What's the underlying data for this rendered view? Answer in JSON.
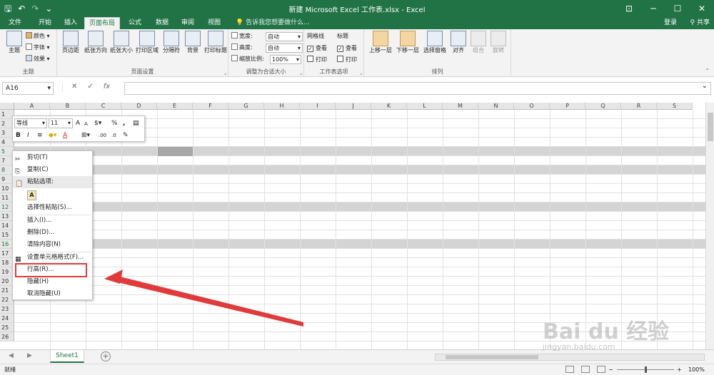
{
  "title_bar": {
    "title": "新建 Microsoft Excel 工作表.xlsx - Excel",
    "qat_icons": [
      "save-icon",
      "undo-icon",
      "redo-icon",
      "customize-icon"
    ],
    "window_controls": [
      "ribbon-display-icon",
      "minimize-icon",
      "maximize-icon",
      "close-icon"
    ]
  },
  "tabs": [
    "文件",
    "开始",
    "插入",
    "页面布局",
    "公式",
    "数据",
    "审阅",
    "视图"
  ],
  "active_tab": "页面布局",
  "tell_me": "告诉我您想要做什么...",
  "account": {
    "signin": "登录",
    "share": "共享"
  },
  "ribbon": {
    "theme_group": {
      "label": "主题",
      "theme_button": "主题",
      "colors": "颜色",
      "fonts": "字体",
      "effects": "效果"
    },
    "page_setup": {
      "label": "页面设置",
      "buttons": [
        "页边距",
        "纸张方向",
        "纸张大小",
        "打印区域",
        "分隔符",
        "背景",
        "打印标题"
      ]
    },
    "scale_to_fit": {
      "label": "调整为合适大小",
      "width_label": "宽度:",
      "width_value": "自动",
      "height_label": "高度:",
      "height_value": "自动",
      "scale_label": "缩放比例:",
      "scale_value": "100%"
    },
    "sheet_options": {
      "label": "工作表选项",
      "gridlines": "网格线",
      "headings": "标题",
      "view": "查看",
      "print": "打印",
      "gridlines_view_checked": "✓",
      "headings_view_checked": "✓"
    },
    "arrange": {
      "label": "排列",
      "buttons": [
        "上移一层",
        "下移一层",
        "选择窗格",
        "对齐",
        "组合",
        "旋转"
      ]
    }
  },
  "formula_bar": {
    "name_box": "A16",
    "cancel": "✕",
    "enter": "✓",
    "fx": "fx",
    "formula": ""
  },
  "grid": {
    "columns": [
      "A",
      "B",
      "C",
      "D",
      "E",
      "F",
      "G",
      "H",
      "I",
      "J",
      "K",
      "L",
      "M",
      "N",
      "O",
      "P",
      "Q",
      "R",
      "S"
    ],
    "rows": [
      "1",
      "2",
      "3",
      "4",
      "5",
      "7",
      "8",
      "9",
      "10",
      "11",
      "12",
      "13",
      "14",
      "15",
      "16",
      "17",
      "18",
      "19",
      "20",
      "21",
      "22",
      "23",
      "24",
      "25",
      "26"
    ],
    "highlighted_rows": [
      "5",
      "8",
      "12",
      "16"
    ]
  },
  "mini_toolbar": {
    "font": "等线",
    "size": "11",
    "grow": "A",
    "shrink": "A",
    "percent": "%",
    "comma": ",",
    "bold": "B",
    "italic": "I",
    "align": "≡",
    "font_color": "A"
  },
  "context_menu": {
    "cut": "剪切(T)",
    "copy": "复制(C)",
    "paste_options": "粘贴选项:",
    "paste_icon": "A",
    "paste_special": "选择性粘贴(S)...",
    "insert": "插入(I)...",
    "delete": "删除(D)...",
    "clear": "清除内容(N)",
    "format_cells": "设置单元格格式(F)...",
    "row_height": "行高(R)...",
    "hide": "隐藏(H)",
    "unhide": "取消隐藏(U)"
  },
  "sheet_tabs": {
    "active": "Sheet1",
    "add": "+"
  },
  "status_bar": {
    "status": "就绪",
    "zoom": "100%",
    "zoom_level_percent": 100
  },
  "watermark": {
    "main": "Bai du 经验",
    "url": "jingyan.baidu.com"
  },
  "colors": {
    "excel_green": "#217346",
    "highlight_red": "#e03a3a"
  }
}
